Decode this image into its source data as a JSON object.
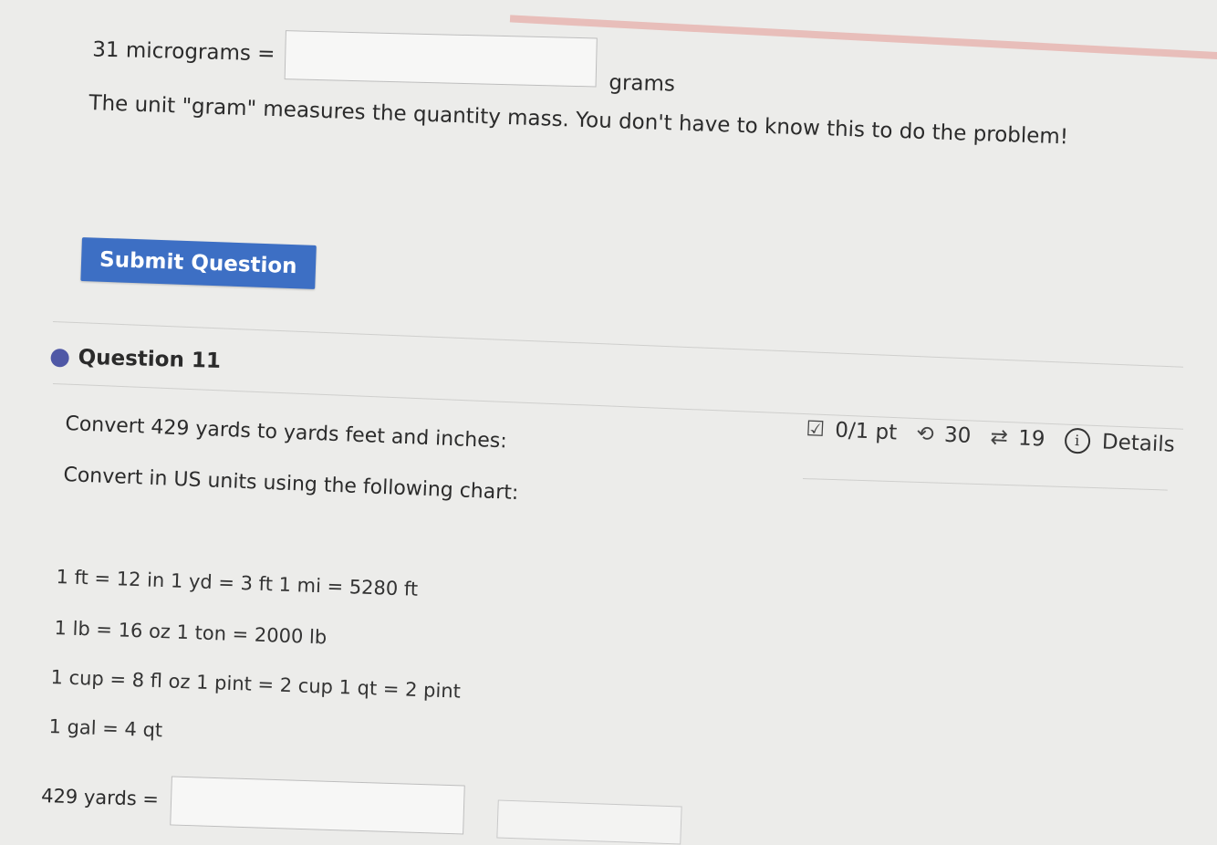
{
  "previous_question": {
    "amount_label": "31 micrograms",
    "equals": "=",
    "answer_value": "",
    "unit": "grams",
    "hint": "The unit \"gram\" measures the quantity mass. You don't have to know this to do the problem!",
    "submit_label": "Submit Question"
  },
  "question": {
    "title": "Question 11",
    "score": "0/1 pt",
    "retries": "30",
    "attempts": "19",
    "details_label": "Details",
    "prompt": "Convert 429 yards to yards feet and inches:",
    "instruction": "Convert in US units using the following chart:",
    "conversions": [
      "1 ft = 12 in 1 yd = 3 ft 1 mi = 5280 ft",
      "1 lb = 16 oz 1 ton = 2000 lb",
      "1 cup = 8 fl oz 1 pint = 2 cup 1 qt = 2 pint",
      "1 gal = 4 qt"
    ],
    "answer_label": "429 yards =",
    "answer_value": ""
  }
}
